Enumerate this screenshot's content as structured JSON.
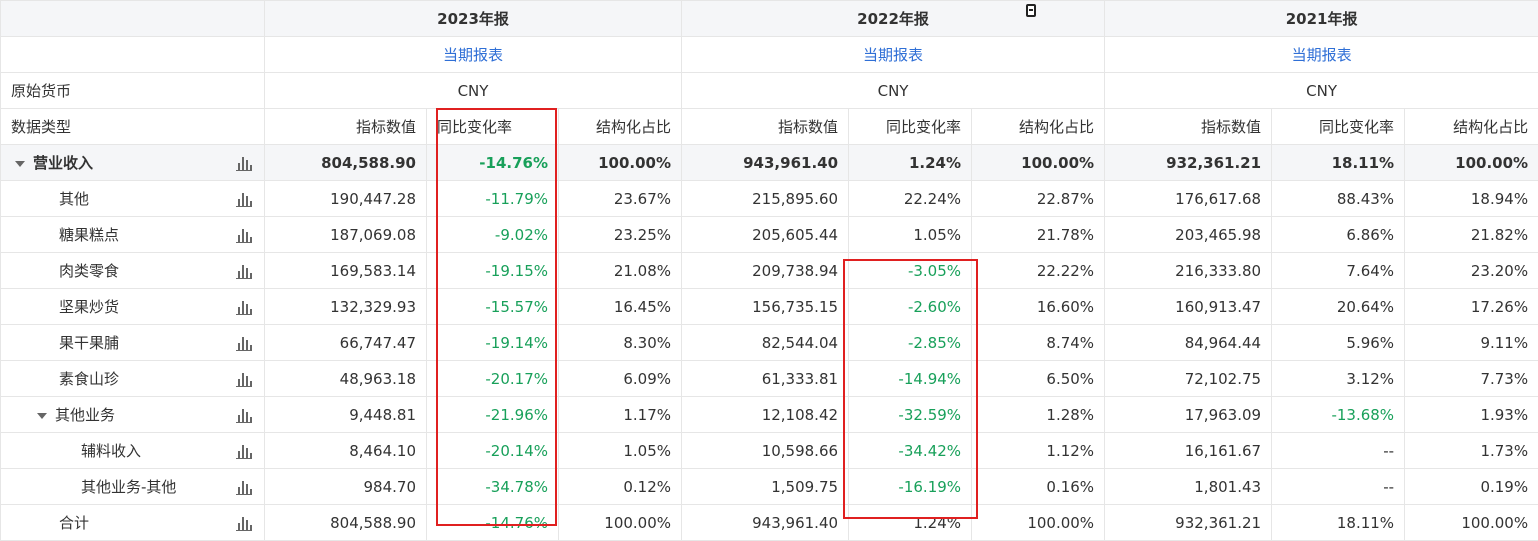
{
  "years": [
    "2023年报",
    "2022年报",
    "2021年报"
  ],
  "report_type_link": "当期报表",
  "currency_label": "原始货币",
  "currency_value": "CNY",
  "data_type_label": "数据类型",
  "col_headers": [
    "指标数值",
    "同比变化率",
    "结构化占比"
  ],
  "rows": [
    {
      "name": "营业收入",
      "level": 0,
      "expand": true,
      "total": true,
      "v": [
        [
          "804,588.90",
          "-14.76%",
          "100.00%"
        ],
        [
          "943,961.40",
          "1.24%",
          "100.00%"
        ],
        [
          "932,361.21",
          "18.11%",
          "100.00%"
        ]
      ]
    },
    {
      "name": "其他",
      "level": 1,
      "v": [
        [
          "190,447.28",
          "-11.79%",
          "23.67%"
        ],
        [
          "215,895.60",
          "22.24%",
          "22.87%"
        ],
        [
          "176,617.68",
          "88.43%",
          "18.94%"
        ]
      ]
    },
    {
      "name": "糖果糕点",
      "level": 1,
      "v": [
        [
          "187,069.08",
          "-9.02%",
          "23.25%"
        ],
        [
          "205,605.44",
          "1.05%",
          "21.78%"
        ],
        [
          "203,465.98",
          "6.86%",
          "21.82%"
        ]
      ]
    },
    {
      "name": "肉类零食",
      "level": 1,
      "v": [
        [
          "169,583.14",
          "-19.15%",
          "21.08%"
        ],
        [
          "209,738.94",
          "-3.05%",
          "22.22%"
        ],
        [
          "216,333.80",
          "7.64%",
          "23.20%"
        ]
      ]
    },
    {
      "name": "坚果炒货",
      "level": 1,
      "v": [
        [
          "132,329.93",
          "-15.57%",
          "16.45%"
        ],
        [
          "156,735.15",
          "-2.60%",
          "16.60%"
        ],
        [
          "160,913.47",
          "20.64%",
          "17.26%"
        ]
      ]
    },
    {
      "name": "果干果脯",
      "level": 1,
      "v": [
        [
          "66,747.47",
          "-19.14%",
          "8.30%"
        ],
        [
          "82,544.04",
          "-2.85%",
          "8.74%"
        ],
        [
          "84,964.44",
          "5.96%",
          "9.11%"
        ]
      ]
    },
    {
      "name": "素食山珍",
      "level": 1,
      "v": [
        [
          "48,963.18",
          "-20.17%",
          "6.09%"
        ],
        [
          "61,333.81",
          "-14.94%",
          "6.50%"
        ],
        [
          "72,102.75",
          "3.12%",
          "7.73%"
        ]
      ]
    },
    {
      "name": "其他业务",
      "level": 1,
      "expand": true,
      "v": [
        [
          "9,448.81",
          "-21.96%",
          "1.17%"
        ],
        [
          "12,108.42",
          "-32.59%",
          "1.28%"
        ],
        [
          "17,963.09",
          "-13.68%",
          "1.93%"
        ]
      ]
    },
    {
      "name": "辅料收入",
      "level": 2,
      "v": [
        [
          "8,464.10",
          "-20.14%",
          "1.05%"
        ],
        [
          "10,598.66",
          "-34.42%",
          "1.12%"
        ],
        [
          "16,161.67",
          "--",
          "1.73%"
        ]
      ]
    },
    {
      "name": "其他业务-其他",
      "level": 2,
      "v": [
        [
          "984.70",
          "-34.78%",
          "0.12%"
        ],
        [
          "1,509.75",
          "-16.19%",
          "0.16%"
        ],
        [
          "1,801.43",
          "--",
          "0.19%"
        ]
      ]
    },
    {
      "name": "合计",
      "level": 1,
      "v": [
        [
          "804,588.90",
          "-14.76%",
          "100.00%"
        ],
        [
          "943,961.40",
          "1.24%",
          "100.00%"
        ],
        [
          "932,361.21",
          "18.11%",
          "100.00%"
        ]
      ]
    }
  ],
  "colors": {
    "negative": "#18a05a",
    "link": "#2f6fd6",
    "highlight": "#e02020",
    "header_bg": "#f5f6f8"
  },
  "icons": {
    "row_chart": "bar-chart-icon",
    "expand": "caret-down-icon",
    "copy": "copy-icon"
  }
}
